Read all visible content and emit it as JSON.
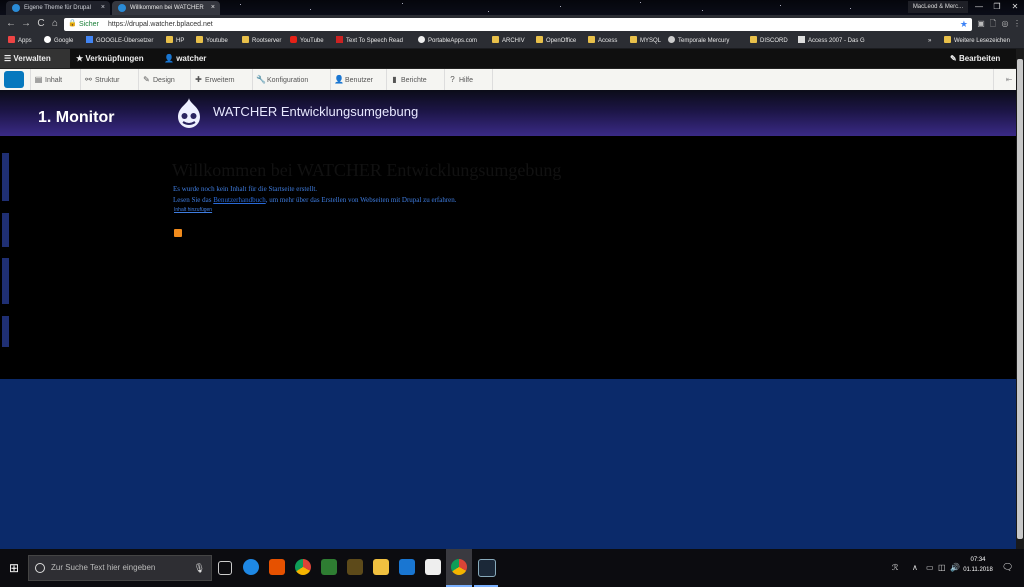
{
  "browser": {
    "tabs": [
      {
        "label": "Eigene Theme für Drupal",
        "close": "×"
      },
      {
        "label": "Willkommen bei WATCHER",
        "close": "×"
      }
    ],
    "profile": "MacLeod & Merc...",
    "window_controls": {
      "minimize": "—",
      "maximize": "❐",
      "close": "✕"
    },
    "nav": {
      "back": "←",
      "forward": "→",
      "reload": "C",
      "home": "⌂"
    },
    "address": {
      "secure_label": "Sicher",
      "url": "https://drupal.watcher.bplaced.net",
      "lock": "🔒",
      "star": "★"
    },
    "extensions": [
      "▣",
      "🗋",
      "◎",
      "⋮"
    ]
  },
  "bookmarks": {
    "items": [
      {
        "label": "Apps",
        "icon": "apps-grid"
      },
      {
        "label": "Google",
        "icon": "google"
      },
      {
        "label": "GOOGLE-Übersetzer",
        "icon": "translate"
      },
      {
        "label": "HP",
        "icon": "folder"
      },
      {
        "label": "Youtube",
        "icon": "folder"
      },
      {
        "label": "Rootserver",
        "icon": "folder"
      },
      {
        "label": "YouTube",
        "icon": "youtube"
      },
      {
        "label": "Text To Speech Read",
        "icon": "speaker"
      },
      {
        "label": "PortableApps.com",
        "icon": "portableapps"
      },
      {
        "label": "ARCHIV",
        "icon": "folder"
      },
      {
        "label": "OpenOffice",
        "icon": "folder"
      },
      {
        "label": "Access",
        "icon": "folder"
      },
      {
        "label": "MYSQL",
        "icon": "folder"
      },
      {
        "label": "Temporale Mercury",
        "icon": "mic"
      },
      {
        "label": "DISCORD",
        "icon": "folder"
      },
      {
        "label": "Access 2007 - Das G",
        "icon": "page"
      }
    ],
    "more": "»",
    "other": "Weitere Lesezeichen"
  },
  "drupal_toolbar": {
    "manage": "Verwalten",
    "shortcuts": "Verknüpfungen",
    "user": "watcher",
    "edit": "Bearbeiten"
  },
  "drupal_tray": {
    "items": [
      {
        "label": "Inhalt",
        "icon": "▤"
      },
      {
        "label": "Struktur",
        "icon": "⚯"
      },
      {
        "label": "Design",
        "icon": "✎"
      },
      {
        "label": "Erweitern",
        "icon": "✚"
      },
      {
        "label": "Konfiguration",
        "icon": "🔧"
      },
      {
        "label": "Benutzer",
        "icon": "👤"
      },
      {
        "label": "Berichte",
        "icon": "▮"
      },
      {
        "label": "Hilfe",
        "icon": "?"
      }
    ],
    "orientation_toggle": "⇤"
  },
  "site": {
    "title": "1. Monitor",
    "name": "WATCHER Entwicklungsumgebung"
  },
  "content": {
    "heading": "Willkommen bei WATCHER Entwicklungsumgebung",
    "msg1": "Es wurde noch kein Inhalt für die Startseite erstellt.",
    "msg2_before": "Lesen Sie das ",
    "msg2_link": "Benutzerhandbuch",
    "msg2_after": ", um mehr über das Erstellen von Webseiten mit Drupal zu erfahren.",
    "add_content": "Inhalt hinzufügen"
  },
  "taskbar": {
    "start": "⊞",
    "search_placeholder": "Zur Suche Text hier eingeben",
    "mic": "🎙",
    "tray": {
      "people": "ℛ",
      "chevron": "∧",
      "battery": "▭",
      "network": "◫",
      "volume": "🔊"
    },
    "time": "07:34",
    "date": "01.11.2018",
    "notifications": "🗨"
  }
}
